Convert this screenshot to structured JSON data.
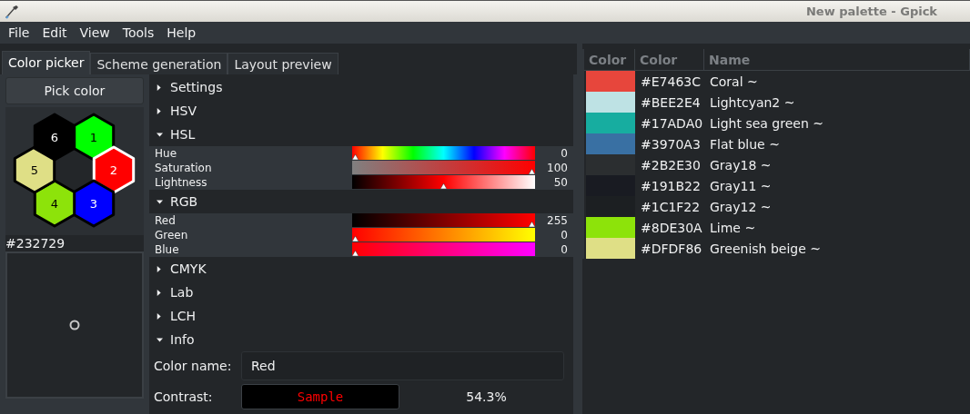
{
  "window": {
    "title": "New palette - Gpick"
  },
  "menu": [
    "File",
    "Edit",
    "View",
    "Tools",
    "Help"
  ],
  "tabs": [
    {
      "label": "Color picker",
      "selected": true
    },
    {
      "label": "Scheme generation",
      "selected": false
    },
    {
      "label": "Layout preview",
      "selected": false
    }
  ],
  "pick_button": "Pick color",
  "swatches": [
    {
      "number": "1",
      "color": "#00ff00",
      "selected": false
    },
    {
      "number": "2",
      "color": "#ff0000",
      "selected": true
    },
    {
      "number": "3",
      "color": "#0000ff",
      "selected": false
    },
    {
      "number": "4",
      "color": "#8de30a",
      "selected": false
    },
    {
      "number": "5",
      "color": "#dfdf86",
      "selected": false
    },
    {
      "number": "6",
      "color": "#000000",
      "selected": false
    }
  ],
  "current_color": "#232729",
  "sections": [
    {
      "label": "Settings",
      "expanded": false
    },
    {
      "label": "HSV",
      "expanded": false
    },
    {
      "label": "HSL",
      "expanded": true,
      "sliders": [
        {
          "label": "Hue",
          "level": 0,
          "reading": "0"
        },
        {
          "label": "Saturation",
          "level": 1,
          "reading": "100"
        },
        {
          "label": "Lightness",
          "level": 0.5,
          "reading": "50"
        }
      ]
    },
    {
      "label": "RGB",
      "expanded": true,
      "sliders": [
        {
          "label": "Red",
          "level": 1,
          "reading": "255"
        },
        {
          "label": "Green",
          "level": 0,
          "reading": "0"
        },
        {
          "label": "Blue",
          "level": 0,
          "reading": "0"
        }
      ]
    },
    {
      "label": "CMYK",
      "expanded": false
    },
    {
      "label": "Lab",
      "expanded": false
    },
    {
      "label": "LCH",
      "expanded": false
    },
    {
      "label": "Info",
      "expanded": true,
      "info": {
        "name_label": "Color name:",
        "name_value": "Red",
        "contrast_label": "Contrast:",
        "sample": "Sample",
        "contrast": "54.3%"
      }
    }
  ],
  "palette": {
    "columns": [
      "Color",
      "Color",
      "Name"
    ],
    "rows": [
      {
        "color": "#e7463c",
        "hex": "#E7463C",
        "name": "Coral ~"
      },
      {
        "color": "#bee2e4",
        "hex": "#BEE2E4",
        "name": "Lightcyan2 ~"
      },
      {
        "color": "#17ada0",
        "hex": "#17ADA0",
        "name": "Light sea green ~"
      },
      {
        "color": "#3970a3",
        "hex": "#3970A3",
        "name": "Flat blue ~"
      },
      {
        "color": "#2b2e30",
        "hex": "#2B2E30",
        "name": "Gray18 ~"
      },
      {
        "color": "#191b22",
        "hex": "#191B22",
        "name": "Gray11 ~"
      },
      {
        "color": "#1c1f22",
        "hex": "#1C1F22",
        "name": "Gray12 ~"
      },
      {
        "color": "#8de30a",
        "hex": "#8DE30A",
        "name": "Lime ~"
      },
      {
        "color": "#dfdf86",
        "hex": "#DFDF86",
        "name": "Greenish beige ~"
      }
    ]
  }
}
